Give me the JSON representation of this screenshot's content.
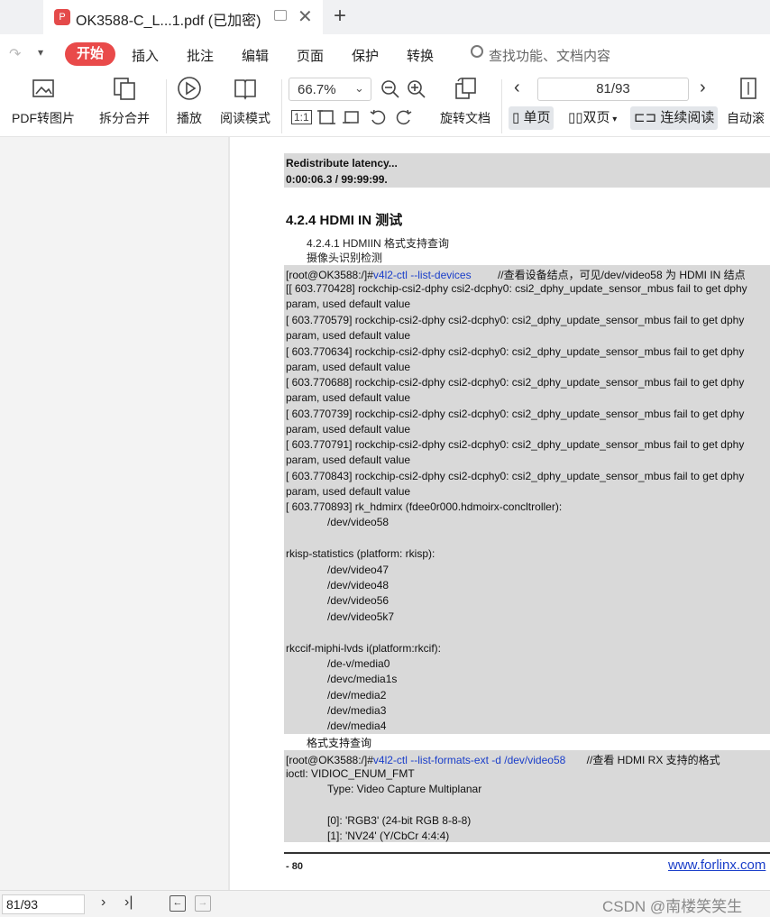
{
  "tab": {
    "badge": "P",
    "title": "OK3588-C_L...1.pdf  (已加密)",
    "close": "✕",
    "new_tab": "+"
  },
  "toolbar_menu": {
    "undo": "↷",
    "more": "▾",
    "start": "开始",
    "items": [
      "插入",
      "批注",
      "编辑",
      "页面",
      "保护",
      "转换"
    ],
    "search_placeholder": "查找功能、文档内容"
  },
  "tools": {
    "pdf_to_image": "PDF转图片",
    "split_merge": "拆分合并",
    "play": "播放",
    "reading_mode": "阅读模式",
    "zoom_value": "66.7%",
    "rotate_doc": "旋转文档",
    "page_indicator": "81/93",
    "single_page": "单页",
    "double_page": "双页",
    "continuous": "连续阅读",
    "auto_scroll": "自动滚"
  },
  "document": {
    "block1": {
      "line1": "Redistribute latency...",
      "line2": "0:00:06.3 / 99:99:99."
    },
    "heading": "4.2.4 HDMI IN  测试",
    "sub_heading": "4.2.4.1 HDMIIN  格式支持查询",
    "sub_note": "摄像头识别检测",
    "cmd1_prefix": "[root@OK3588:/]#",
    "cmd1": "v4l2-ctl --list-devices",
    "cmd1_comment": "//查看设备结点，可见/dev/video58 为 HDMI IN 结点",
    "log_lines": [
      "[[    603.770428] rockchip-csi2-dphy csi2-dcphy0: csi2_dphy_update_sensor_mbus fail to get dphy",
      "param, used default value",
      "[    603.770579] rockchip-csi2-dphy csi2-dcphy0: csi2_dphy_update_sensor_mbus fail to get dphy",
      "param, used default value",
      "[    603.770634] rockchip-csi2-dphy csi2-dcphy0: csi2_dphy_update_sensor_mbus fail to get dphy",
      "param, used default value",
      "[    603.770688] rockchip-csi2-dphy csi2-dcphy0: csi2_dphy_update_sensor_mbus fail to get dphy",
      "param, used default value",
      "[    603.770739] rockchip-csi2-dphy csi2-dcphy0: csi2_dphy_update_sensor_mbus fail to get dphy",
      "param, used default value",
      "[    603.770791] rockchip-csi2-dphy csi2-dcphy0: csi2_dphy_update_sensor_mbus fail to get dphy",
      "param, used default value",
      "[    603.770843] rockchip-csi2-dphy csi2-dcphy0: csi2_dphy_update_sensor_mbus fail to get dphy",
      "param, used default value",
      "[    603.770893] rk_hdmirx (fdee0r000.hdmoirx-concltroller):"
    ],
    "dev_video58": "/dev/video58",
    "rkisp_title": "rkisp-statistics (platform: rkisp):",
    "rkisp_devs": [
      "/dev/video47",
      "/dev/video48",
      "/dev/video56",
      "/dev/video5k7"
    ],
    "rkcif_title": "rkccif-miphi-lvds i(platform:rkcif):",
    "rkcif_devs": [
      "/de-v/media0",
      "/devc/media1s",
      "/dev/media2",
      "/dev/media3",
      "/dev/media4"
    ],
    "format_note": "格式支持查询",
    "cmd2_prefix": "[root@OK3588:/]#",
    "cmd2": "v4l2-ctl --list-formats-ext -d /dev/video58",
    "cmd2_comment": "//查看 HDMI RX 支持的格式",
    "ioctl": "ioctl: VIDIOC_ENUM_FMT",
    "type_line": "Type: Video Capture Multiplanar",
    "fmt0": "[0]: 'RGB3' (24-bit RGB 8-8-8)",
    "fmt1": "[1]: 'NV24' (Y/CbCr 4:4:4)",
    "footer_page": "- 80",
    "footer_link": "www.forlinx.com"
  },
  "statusbar": {
    "page": "81/93",
    "watermark": "CSDN @南楼笑笑生"
  }
}
